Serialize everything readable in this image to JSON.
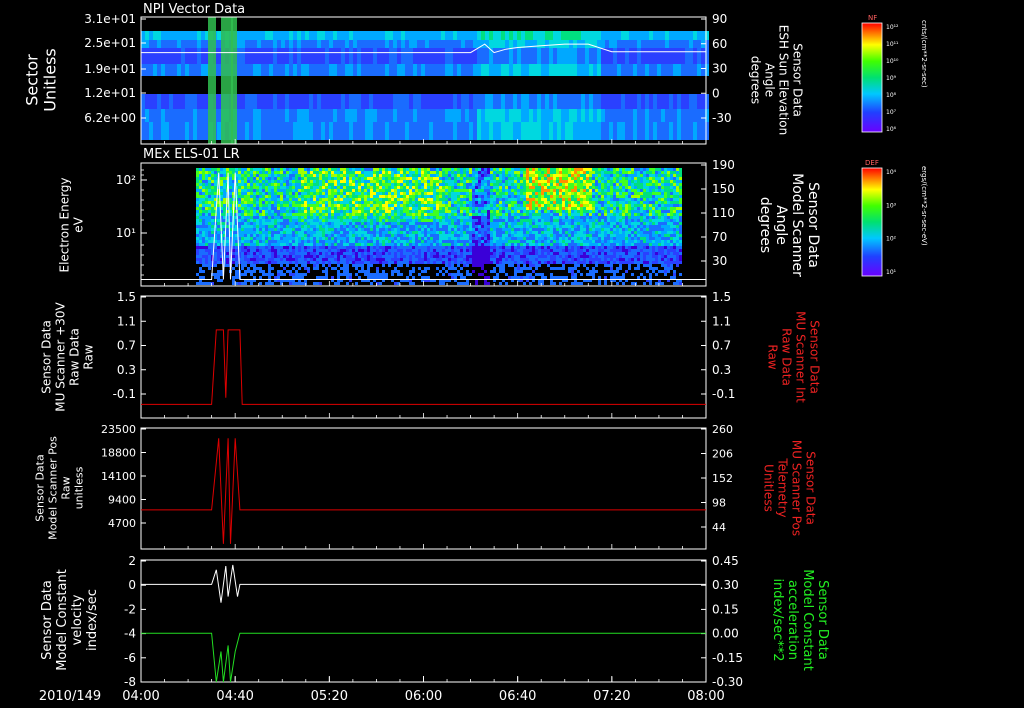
{
  "figure": {
    "date_label": "2010/149",
    "x_ticks": [
      "04:00",
      "04:40",
      "05:20",
      "06:00",
      "06:40",
      "07:20",
      "08:00"
    ]
  },
  "colors": {
    "background": "#000000",
    "axes": "#ffffff",
    "trace_white": "#ffffff",
    "trace_red": "#dd0000",
    "trace_green": "#22dd22",
    "label_red": "#ee2222",
    "label_green": "#22ee22"
  },
  "colorbars": [
    {
      "tag": "NF",
      "unit": "cnts/(cm**2-sr-sec)",
      "ticks": [
        "10¹²",
        "10¹¹",
        "10¹⁰",
        "10⁹",
        "10⁸",
        "10⁷",
        "10⁶"
      ]
    },
    {
      "tag": "DEF",
      "unit": "ergs/(cm**2-sr-sec-eV)",
      "ticks": [
        "10⁴",
        "10³",
        "10²",
        "10¹"
      ]
    }
  ],
  "chart_data": [
    {
      "type": "heatmap",
      "title": "NPI Vector Data",
      "ylabel_left": [
        "Sector",
        "Unitless"
      ],
      "ylabel_right": [
        "Sensor Data",
        "ESH Sun Elevation",
        "Angle",
        "degrees"
      ],
      "y_ticks_left": [
        "3.1e+01",
        "2.5e+01",
        "1.9e+01",
        "1.2e+01",
        "6.2e+00"
      ],
      "y_ticks_right": [
        "90",
        "60",
        "30",
        "0",
        "-30"
      ],
      "ylim_right": [
        -60,
        90
      ],
      "overlay_series": {
        "name": "ESH Sun Elevation Angle",
        "x": [
          "04:00",
          "05:00",
          "06:00",
          "06:20",
          "06:26",
          "06:30",
          "06:35",
          "06:40",
          "06:50",
          "07:00",
          "07:10",
          "07:20",
          "08:00"
        ],
        "y": [
          48,
          48,
          48,
          48,
          58,
          48,
          52,
          54,
          56,
          58,
          58,
          49,
          49
        ]
      }
    },
    {
      "type": "heatmap",
      "title": "MEx ELS-01 LR",
      "ylabel_left": [
        "Electron Energy",
        "eV"
      ],
      "ylabel_right": [
        "Sensor Data",
        "Model Scanner",
        "Angle",
        "degrees"
      ],
      "y_ticks_left": [
        "10²",
        "10¹"
      ],
      "y_ticks_right": [
        "190",
        "150",
        "110",
        "70",
        "30"
      ],
      "ylim_right": [
        0,
        190
      ],
      "overlay_series": {
        "name": "Model Scanner Angle",
        "x": [
          "04:00",
          "04:30",
          "04:33",
          "04:35",
          "04:37",
          "04:38",
          "04:40",
          "04:42",
          "04:43",
          "08:00"
        ],
        "y": [
          10,
          10,
          175,
          10,
          175,
          10,
          175,
          10,
          10,
          10
        ]
      }
    },
    {
      "type": "line",
      "ylabel_left": [
        "Sensor Data",
        "MU Scanner +30V",
        "Raw Data",
        "Raw"
      ],
      "ylabel_right": [
        "Sensor Data",
        "MU Scanner Int",
        "Raw Data",
        "Raw"
      ],
      "y_ticks_left": [
        "1.5",
        "1.1",
        "0.7",
        "0.3",
        "-0.1"
      ],
      "y_ticks_right": [
        "1.5",
        "1.1",
        "0.7",
        "0.3",
        "-0.1"
      ],
      "ylim": [
        -0.3,
        1.5
      ],
      "series": [
        {
          "x": [
            "04:00",
            "04:30",
            "04:32",
            "04:35",
            "04:36",
            "04:37",
            "04:38",
            "04:39",
            "04:42",
            "04:43",
            "08:00"
          ],
          "y": [
            -0.1,
            -0.1,
            1.0,
            1.0,
            0.0,
            1.0,
            1.0,
            1.0,
            1.0,
            -0.1,
            -0.1
          ]
        }
      ]
    },
    {
      "type": "line",
      "ylabel_left": [
        "Sensor Data",
        "Model Scanner Pos",
        "Raw",
        "unitless"
      ],
      "ylabel_right": [
        "Sensor Data",
        "MU Scanner Pos",
        "Telemetry",
        "Unitless"
      ],
      "y_ticks_left": [
        "23500",
        "18800",
        "14100",
        "9400",
        "4700"
      ],
      "y_ticks_right": [
        "260",
        "206",
        "152",
        "98",
        "44"
      ],
      "ylim": [
        0,
        23500
      ],
      "series": [
        {
          "x": [
            "04:00",
            "04:30",
            "04:33",
            "04:35",
            "04:37",
            "04:38",
            "04:40",
            "04:42",
            "04:44",
            "08:00"
          ],
          "y": [
            7600,
            7600,
            21500,
            1000,
            21500,
            1000,
            21500,
            7600,
            7600,
            7600
          ]
        }
      ]
    },
    {
      "type": "line",
      "ylabel_left": [
        "Sensor Data",
        "Model Constant",
        "velocity",
        "index/sec"
      ],
      "ylabel_right": [
        "Sensor Data",
        "Model Constant",
        "acceleration",
        "index/sec**2"
      ],
      "y_ticks_left": [
        "2",
        "0",
        "-2",
        "-4",
        "-6",
        "-8"
      ],
      "y_ticks_right": [
        "0.45",
        "0.30",
        "0.15",
        "0.00",
        "-0.15",
        "-0.30"
      ],
      "ylim": [
        -8,
        2
      ],
      "series": [
        {
          "name": "velocity",
          "x": [
            "04:00",
            "04:30",
            "04:32",
            "04:34",
            "04:36",
            "04:37",
            "04:39",
            "04:41",
            "04:42",
            "08:00"
          ],
          "y": [
            0,
            0,
            1.2,
            -1.5,
            1.5,
            -1.0,
            1.6,
            -1.0,
            0,
            0
          ]
        },
        {
          "name": "acceleration",
          "x": [
            "04:00",
            "04:30",
            "04:32",
            "04:34",
            "04:35",
            "04:37",
            "04:38",
            "04:40",
            "04:42",
            "08:00"
          ],
          "y": [
            -4,
            -4,
            -8,
            -5.5,
            -8,
            -5,
            -8,
            -5.5,
            -4,
            -4
          ]
        }
      ]
    }
  ]
}
